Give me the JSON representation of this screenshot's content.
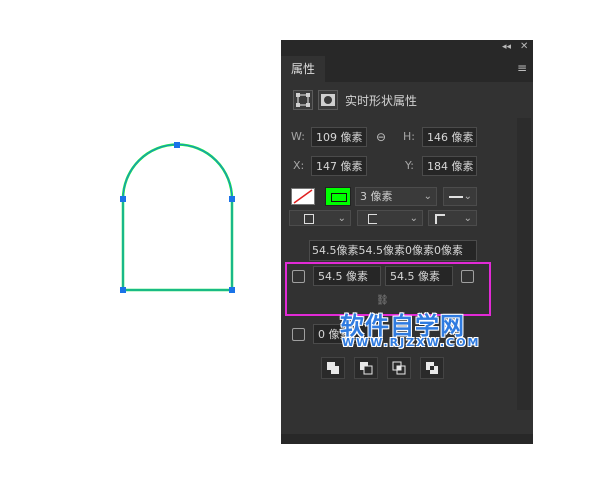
{
  "panel": {
    "tab_label": "属性",
    "section_title": "实时形状属性",
    "icons": {
      "collapse": "double-chevron-left-icon",
      "close": "close-icon",
      "menu": "hamburger-menu-icon",
      "transform": "transform-bounds-icon",
      "mask": "mask-icon",
      "link": "link-chain-icon"
    },
    "dimensions": {
      "w_label": "W:",
      "w_value": "109 像素",
      "h_label": "H:",
      "h_value": "146 像素",
      "x_label": "X:",
      "x_value": "147 像素",
      "y_label": "Y:",
      "y_value": "184 像素"
    },
    "stroke": {
      "fill_swatch": "no-fill",
      "stroke_color": "#00ff00",
      "stroke_width": "3 像素",
      "line_style": "solid"
    },
    "corners": {
      "combined_value": "54.5像素54.5像素0像素0像素",
      "top_left": "54.5 像素",
      "top_right": "54.5 像素"
    },
    "extra_row": {
      "value": "0 像素"
    },
    "path_ops": [
      "combine",
      "subtract",
      "intersect",
      "exclude"
    ]
  },
  "shape": {
    "stroke_color": "#19e64a",
    "anchor_color": "#1a73e8"
  },
  "annotation": {
    "highlight_color": "#e22ad6"
  },
  "watermark": {
    "title": "软件自学网",
    "url": "WWW.RJZXW.COM"
  }
}
